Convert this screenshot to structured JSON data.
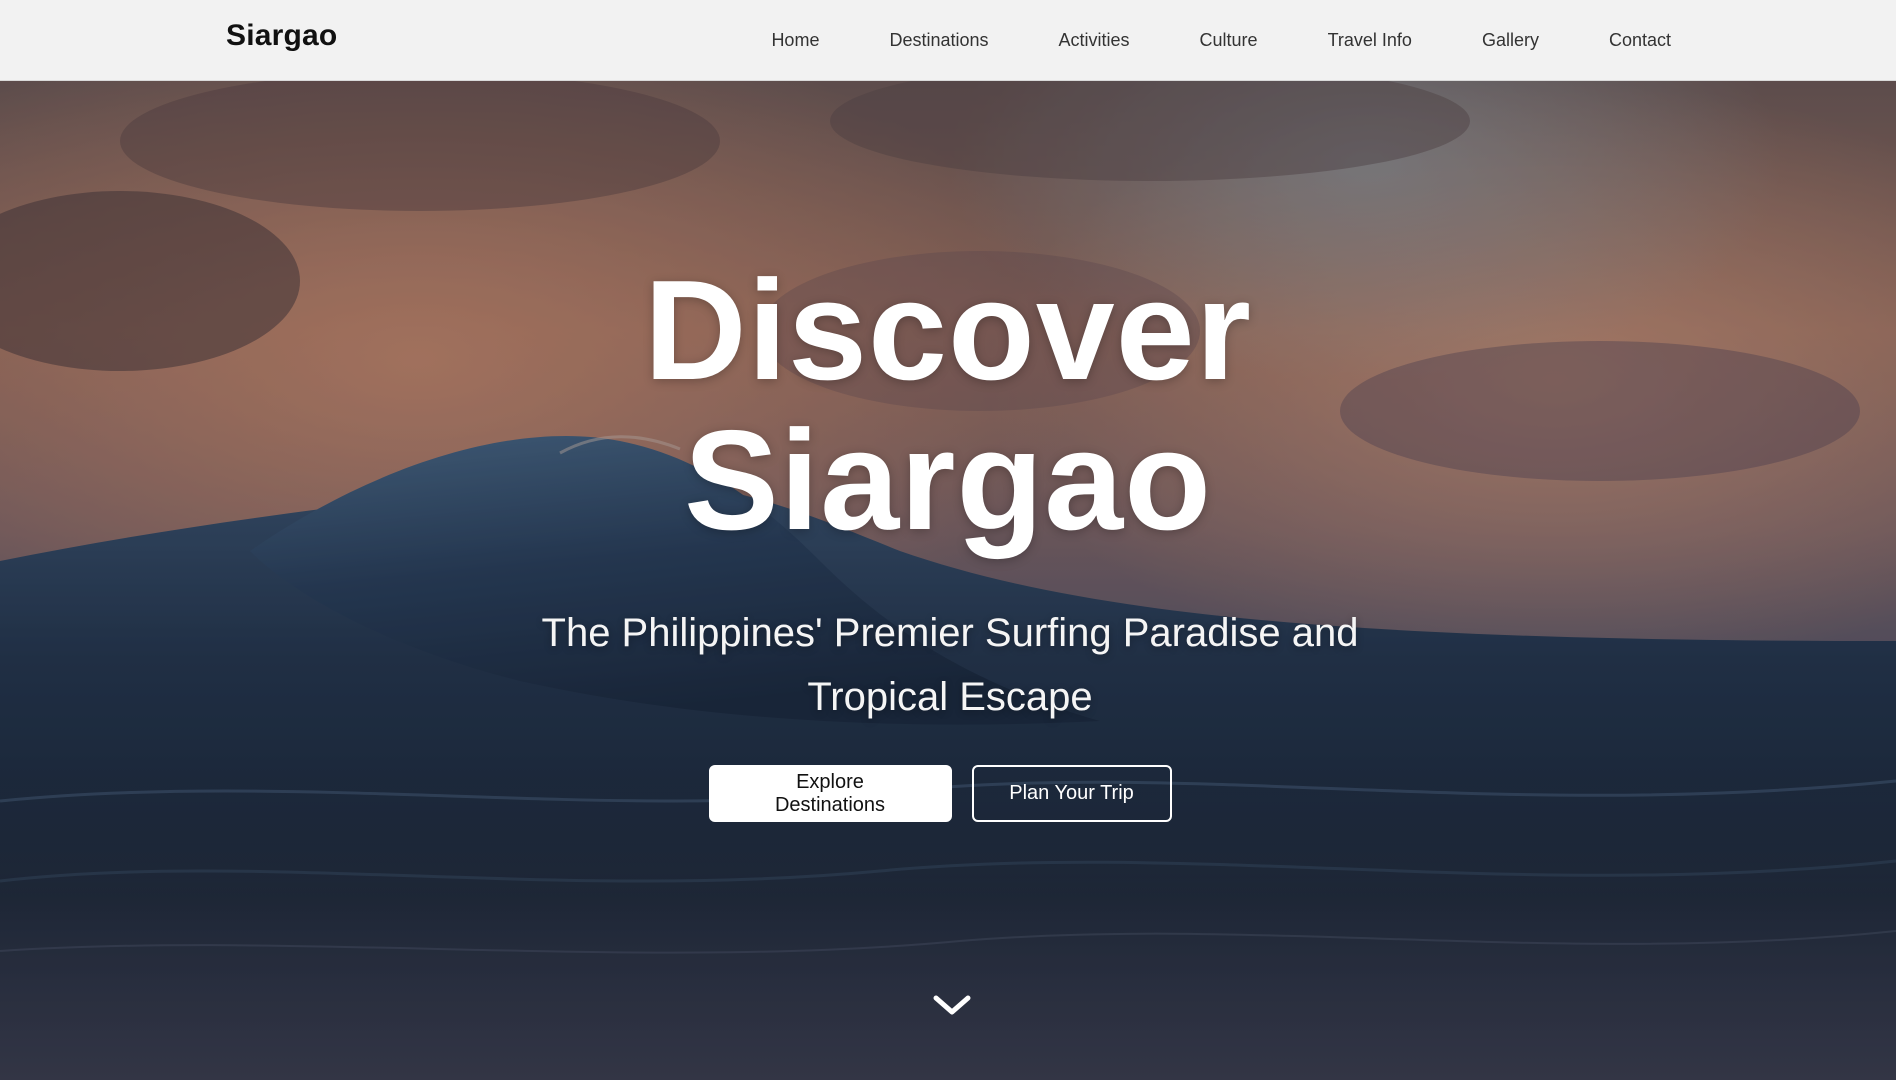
{
  "site": {
    "logo": "Siargao"
  },
  "nav": {
    "items": [
      {
        "label": "Home"
      },
      {
        "label": "Destinations"
      },
      {
        "label": "Activities"
      },
      {
        "label": "Culture"
      },
      {
        "label": "Travel Info"
      },
      {
        "label": "Gallery"
      },
      {
        "label": "Contact"
      }
    ]
  },
  "hero": {
    "title_line1": "Discover",
    "title_line2": "Siargao",
    "subtitle": "The Philippines' Premier Surfing Paradise and Tropical Escape",
    "primary_button": "Explore Destinations",
    "secondary_button": "Plan Your Trip",
    "scroll_icon": "chevron-down-icon"
  },
  "colors": {
    "header_bg": "#f2f2f2",
    "logo_text": "#111111",
    "nav_text": "#333333",
    "hero_text": "#ffffff",
    "sky_warm": "#b07a66",
    "ocean_deep": "#1b2c44"
  }
}
